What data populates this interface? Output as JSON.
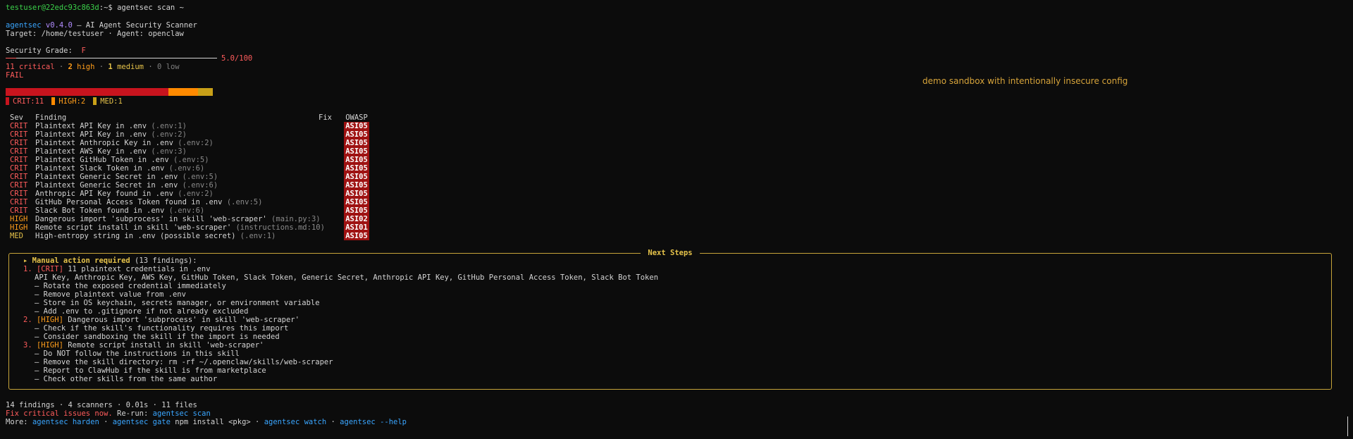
{
  "terminal": {
    "prompt_user": "testuser@22edc93c863d",
    "prompt_path": ":~$ ",
    "command": "agentsec scan ~"
  },
  "header": {
    "tool_name": "agentsec",
    "version": "v0.4.0",
    "tagline": " — AI Agent Security Scanner",
    "target_line": "Target: /home/testuser · Agent: openclaw"
  },
  "grade": {
    "label": "Security Grade:  ",
    "letter": "F",
    "score_text": "5.0/100",
    "score_fraction": 0.05,
    "status": "FAIL"
  },
  "counts": {
    "critical": "11 critical",
    "high_n": "2",
    "high_w": " high",
    "medium_n": "1",
    "medium_w": " medium",
    "low": "0 low",
    "sep": " · "
  },
  "severity_bar": {
    "segments": [
      {
        "label": "CRIT:11",
        "value": 11,
        "color": "#c8141e"
      },
      {
        "label": "HIGH:2",
        "value": 2,
        "color": "#ff8a00"
      },
      {
        "label": "MED:1",
        "value": 1,
        "color": "#c8a018"
      }
    ]
  },
  "annotation": "demo sandbox with intentionally insecure config",
  "table": {
    "headers": {
      "sev": "Sev",
      "finding": "Finding",
      "fix": "Fix",
      "owasp": "OWASP"
    },
    "rows": [
      {
        "sev": "CRIT",
        "finding": "Plaintext API Key in .env",
        "loc": " (.env:1)",
        "owasp": "ASI05"
      },
      {
        "sev": "CRIT",
        "finding": "Plaintext API Key in .env",
        "loc": " (.env:2)",
        "owasp": "ASI05"
      },
      {
        "sev": "CRIT",
        "finding": "Plaintext Anthropic Key in .env",
        "loc": " (.env:2)",
        "owasp": "ASI05"
      },
      {
        "sev": "CRIT",
        "finding": "Plaintext AWS Key in .env",
        "loc": " (.env:3)",
        "owasp": "ASI05"
      },
      {
        "sev": "CRIT",
        "finding": "Plaintext GitHub Token in .env",
        "loc": " (.env:5)",
        "owasp": "ASI05"
      },
      {
        "sev": "CRIT",
        "finding": "Plaintext Slack Token in .env",
        "loc": " (.env:6)",
        "owasp": "ASI05"
      },
      {
        "sev": "CRIT",
        "finding": "Plaintext Generic Secret in .env",
        "loc": " (.env:5)",
        "owasp": "ASI05"
      },
      {
        "sev": "CRIT",
        "finding": "Plaintext Generic Secret in .env",
        "loc": " (.env:6)",
        "owasp": "ASI05"
      },
      {
        "sev": "CRIT",
        "finding": "Anthropic API Key found in .env",
        "loc": " (.env:2)",
        "owasp": "ASI05"
      },
      {
        "sev": "CRIT",
        "finding": "GitHub Personal Access Token found in .env",
        "loc": " (.env:5)",
        "owasp": "ASI05"
      },
      {
        "sev": "CRIT",
        "finding": "Slack Bot Token found in .env",
        "loc": " (.env:6)",
        "owasp": "ASI05"
      },
      {
        "sev": "HIGH",
        "finding": "Dangerous import 'subprocess' in skill 'web-scraper'",
        "loc": " (main.py:3)",
        "owasp": "ASI02"
      },
      {
        "sev": "HIGH",
        "finding": "Remote script install in skill 'web-scraper'",
        "loc": " (instructions.md:10)",
        "owasp": "ASI01"
      },
      {
        "sev": "MED",
        "finding": "High-entropy string in .env (possible secret)",
        "loc": " (.env:1)",
        "owasp": "ASI05"
      }
    ]
  },
  "next_steps": {
    "title": " Next Steps ",
    "manual_marker": "▸ ",
    "manual_label": "Manual action required",
    "manual_count": " (13 findings):",
    "items": [
      {
        "num": "1. ",
        "tag": "[CRIT]",
        "title": " 11 plaintext credentials in .env",
        "lines": [
          "API Key, Anthropic Key, AWS Key, GitHub Token, Slack Token, Generic Secret, Anthropic API Key, GitHub Personal Access Token, Slack Bot Token",
          "– Rotate the exposed credential immediately",
          "– Remove plaintext value from .env",
          "– Store in OS keychain, secrets manager, or environment variable",
          "– Add .env to .gitignore if not already excluded"
        ]
      },
      {
        "num": "2. ",
        "tag": "[HIGH]",
        "title": " Dangerous import 'subprocess' in skill 'web-scraper'",
        "lines": [
          "– Check if the skill's functionality requires this import",
          "– Consider sandboxing the skill if the import is needed"
        ]
      },
      {
        "num": "3. ",
        "tag": "[HIGH]",
        "title": " Remote script install in skill 'web-scraper'",
        "lines": [
          "– Do NOT follow the instructions in this skill",
          "– Remove the skill directory: rm -rf ~/.openclaw/skills/web-scraper",
          "– Report to ClawHub if the skill is from marketplace",
          "– Check other skills from the same author"
        ]
      }
    ]
  },
  "footer": {
    "summary": "14 findings · 4 scanners · 0.01s · 11 files",
    "fix_text": "Fix critical issues now.",
    "rerun_label": " Re-run: ",
    "rerun_cmd": "agentsec scan",
    "more_label": "More: ",
    "more_1": "agentsec harden",
    "sep": " · ",
    "more_2": "agentsec gate",
    "more_2_args": " npm install <pkg>",
    "more_3": "agentsec watch",
    "more_4": "agentsec",
    "more_4_flag": " --help"
  }
}
